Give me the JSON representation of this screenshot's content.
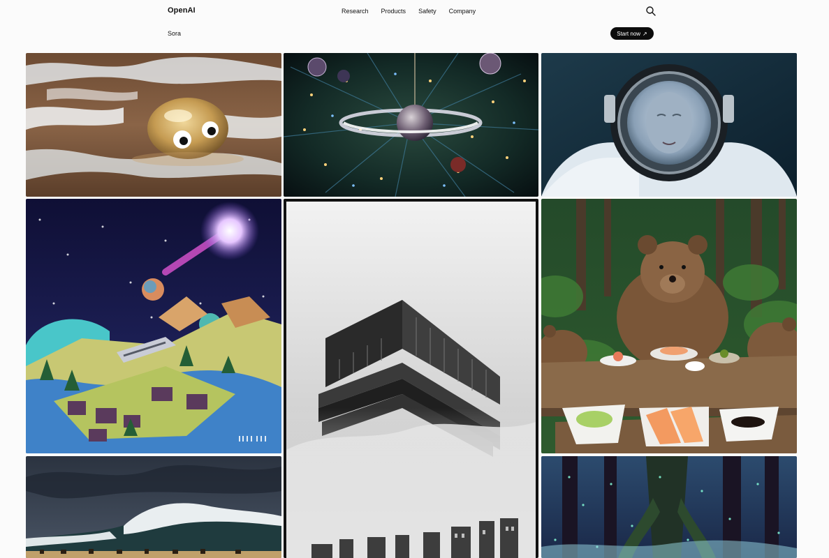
{
  "nav": {
    "brand": "OpenAI",
    "items": [
      {
        "label": "Research"
      },
      {
        "label": "Products"
      },
      {
        "label": "Safety"
      },
      {
        "label": "Company"
      }
    ],
    "search_icon": "search-icon"
  },
  "subnav": {
    "product": "Sora",
    "cta_label": "Start now",
    "cta_icon": "arrow-up-right-icon"
  },
  "gallery": {
    "tiles": [
      {
        "subject": "glass blob with googly eyes in surf"
      },
      {
        "subject": "christmas tree ornament with ring"
      },
      {
        "subject": "astronaut portrait"
      },
      {
        "subject": "papercraft planet scene with spaceship"
      },
      {
        "subject": "foggy brutalist building"
      },
      {
        "subject": "bears at wooden table with sushi"
      },
      {
        "subject": "ocean wave under storm clouds"
      },
      {
        "subject": "glowing enchanted forest"
      }
    ]
  },
  "colors": {
    "background": "#fbfbfb",
    "cta_background": "#0c0c0c",
    "cta_text": "#ffffff"
  }
}
